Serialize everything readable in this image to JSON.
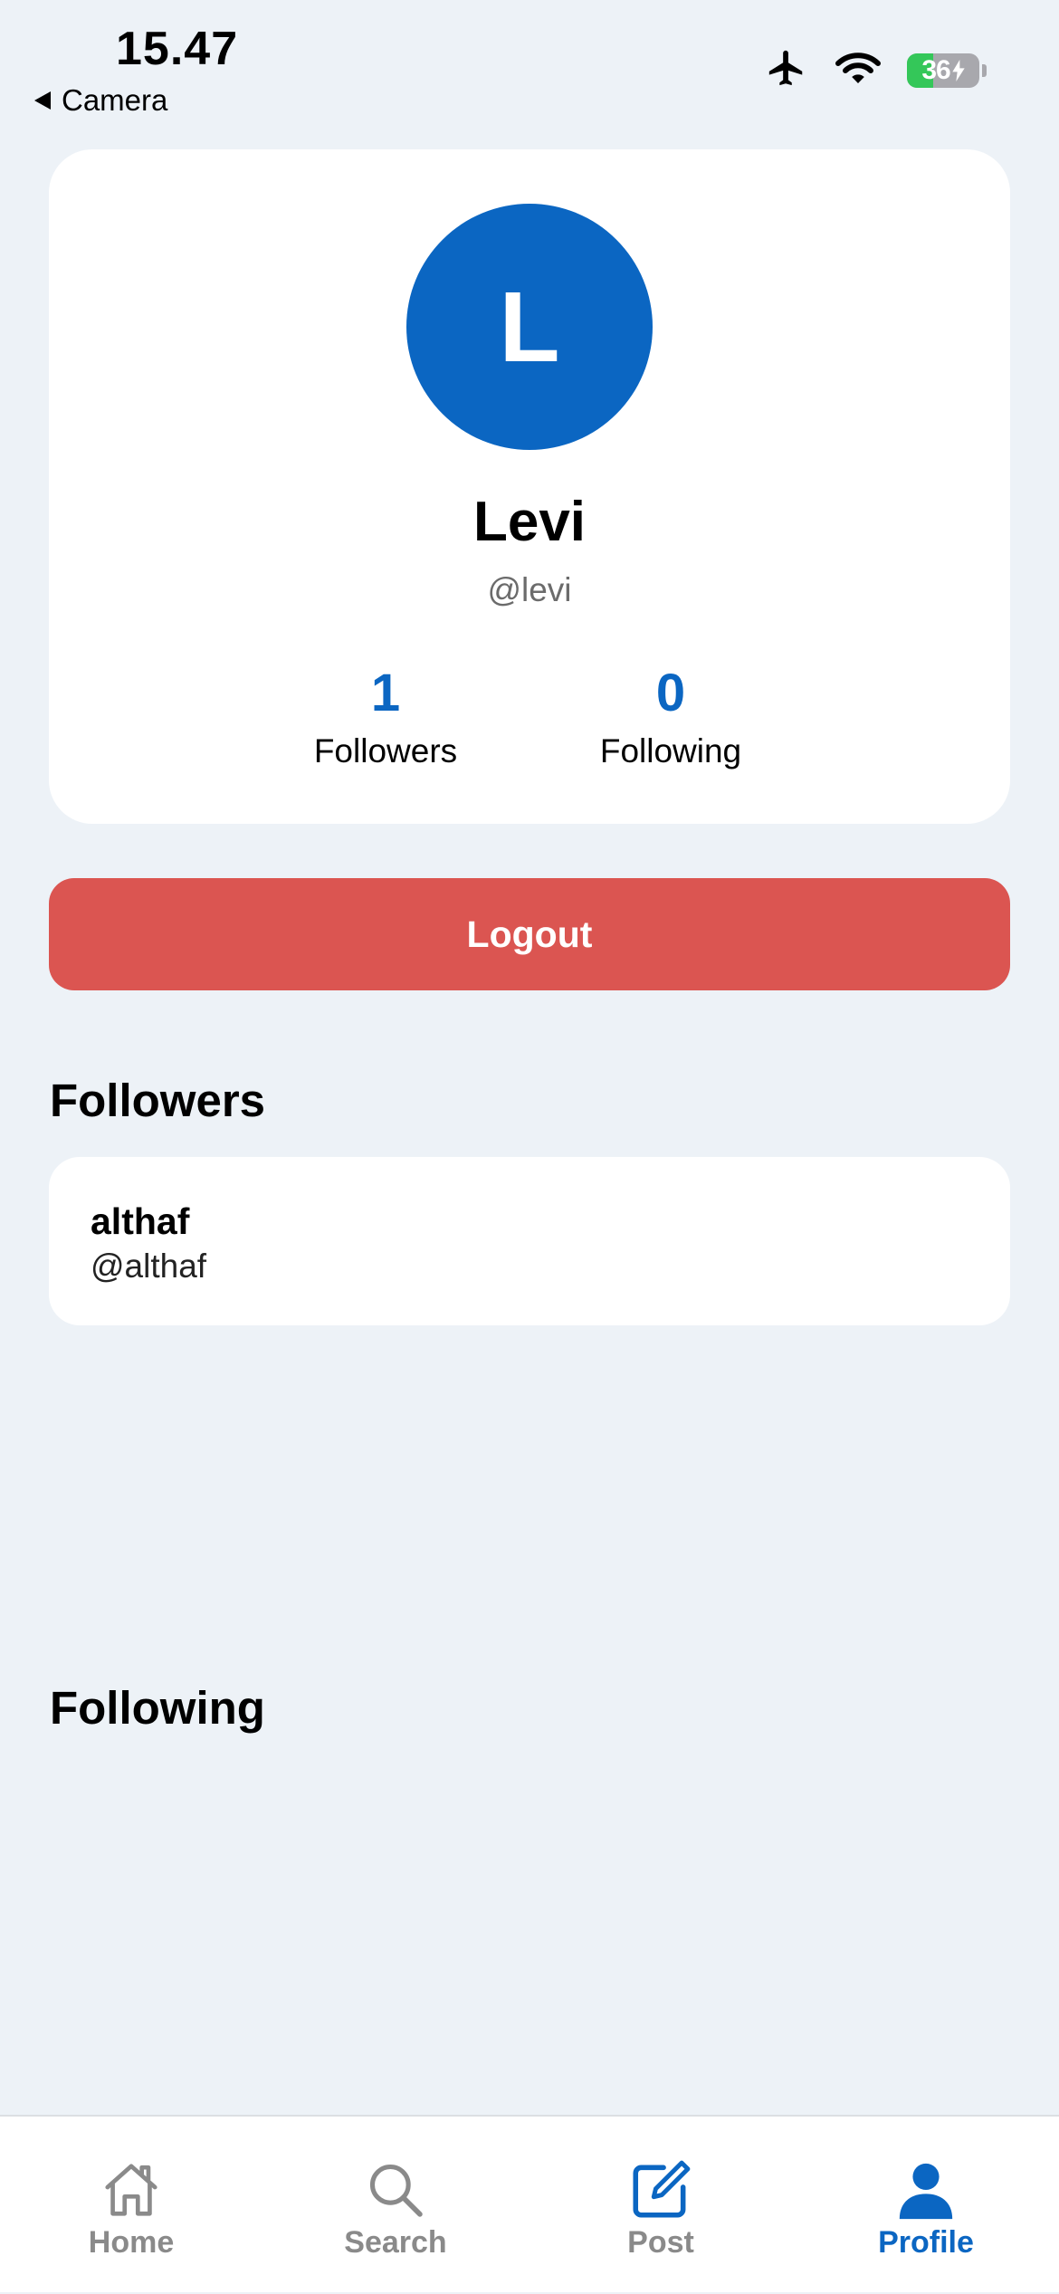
{
  "status_bar": {
    "time": "15.47",
    "back_label": "Camera",
    "battery_percent": "36",
    "battery_level": 0.36
  },
  "profile": {
    "avatar_initial": "L",
    "name": "Levi",
    "handle": "@levi",
    "followers_count": "1",
    "followers_label": "Followers",
    "following_count": "0",
    "following_label": "Following"
  },
  "actions": {
    "logout_label": "Logout"
  },
  "followers_section": {
    "title": "Followers",
    "items": [
      {
        "name": "althaf",
        "handle": "@althaf"
      }
    ]
  },
  "following_section": {
    "title": "Following",
    "items": []
  },
  "tab_bar": {
    "tabs": [
      {
        "label": "Home",
        "icon": "home-icon"
      },
      {
        "label": "Search",
        "icon": "search-icon"
      },
      {
        "label": "Post",
        "icon": "compose-icon"
      },
      {
        "label": "Profile",
        "icon": "person-icon"
      }
    ],
    "active": "Profile"
  },
  "colors": {
    "accent": "#0b66c2",
    "danger": "#db5551",
    "background": "#edf2f7",
    "inactive_tab": "#8a8a8a"
  }
}
